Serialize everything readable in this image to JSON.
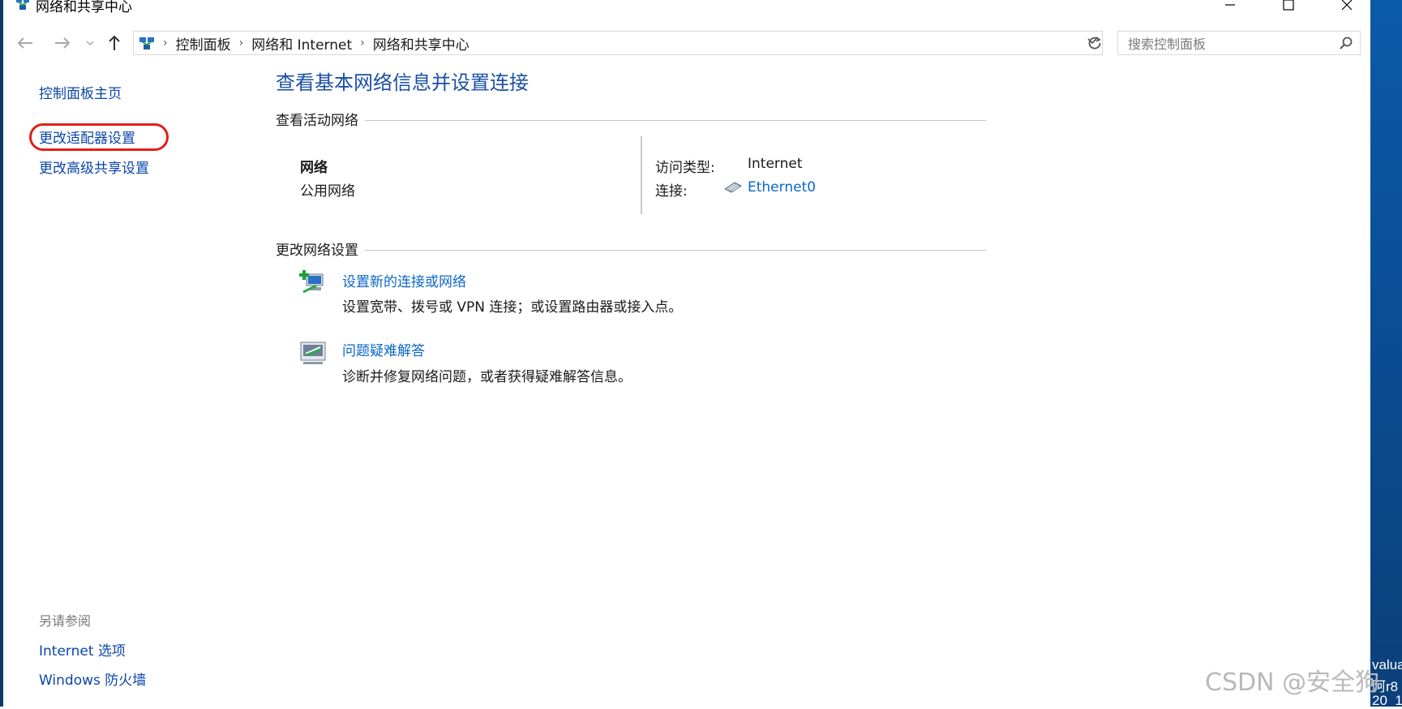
{
  "window": {
    "title": "网络和共享中心",
    "minimize_icon": "minimize-icon",
    "maximize_icon": "maximize-icon",
    "close_icon": "close-icon"
  },
  "addressbar": {
    "breadcrumbs": [
      "控制面板",
      "网络和 Internet",
      "网络和共享中心"
    ],
    "search_placeholder": "搜索控制面板"
  },
  "sidebar": {
    "home": "控制面板主页",
    "links": [
      "更改适配器设置",
      "更改高级共享设置"
    ],
    "see_also_heading": "另请参阅",
    "see_also": [
      "Internet 选项",
      "Windows 防火墙"
    ]
  },
  "main": {
    "title": "查看基本网络信息并设置连接",
    "active_section": "查看活动网络",
    "network": {
      "name": "网络",
      "type": "公用网络",
      "access_label": "访问类型:",
      "access_value": "Internet",
      "conn_label": "连接:",
      "conn_value": "Ethernet0"
    },
    "change_section": "更改网络设置",
    "tasks": [
      {
        "link": "设置新的连接或网络",
        "desc": "设置宽带、拨号或 VPN 连接；或设置路由器或接入点。",
        "icon": "new-connection-icon"
      },
      {
        "link": "问题疑难解答",
        "desc": "诊断并修复网络问题，或者获得疑难解答信息。",
        "icon": "troubleshoot-icon"
      }
    ]
  },
  "desktop_right": {
    "lines": [
      "valua",
      "阿r8",
      "20_1"
    ]
  },
  "watermark": "CSDN @安全狗",
  "colors": {
    "link": "#0b66c8",
    "sidebar_link": "#0b46a8",
    "title": "#1b4fa6",
    "highlight": "#e0201b"
  }
}
